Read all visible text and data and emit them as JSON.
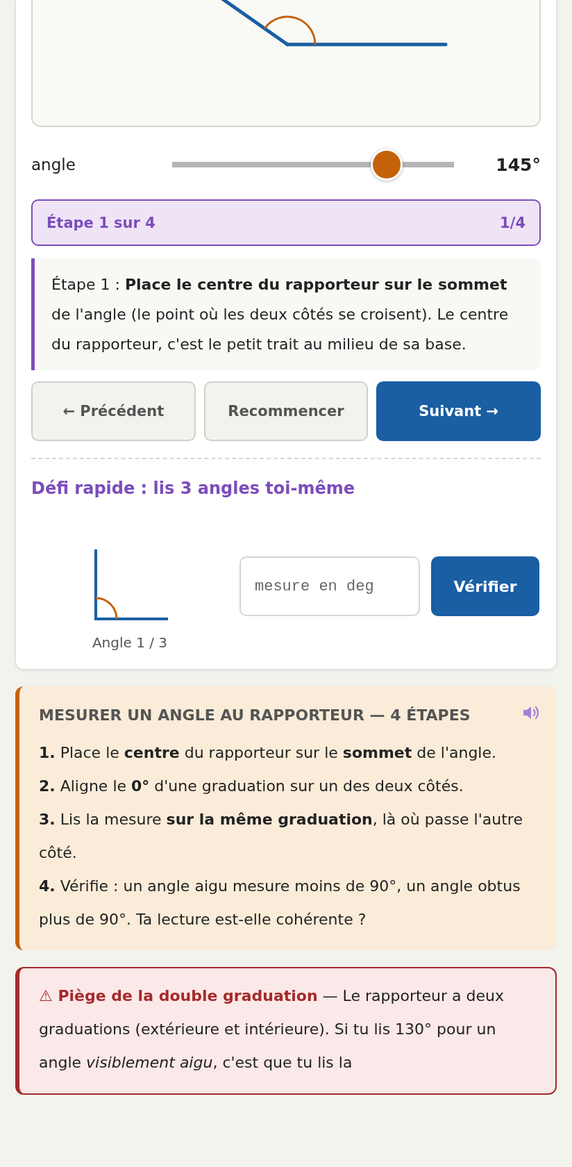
{
  "slider": {
    "label": "angle",
    "level": 0.76,
    "reading": "145°"
  },
  "step_banner": {
    "title": "Étape 1 sur 4",
    "counter": "1/4"
  },
  "instruction": "Étape 1 : **Place le centre du rapporteur sur le sommet** de l'angle (le point où les deux côtés se croisent). Le centre du rapporteur, c'est le petit trait au milieu de sa base.",
  "buttons": [
    {
      "label": "← Précédent",
      "kind": "secondary"
    },
    {
      "label": "Recommencer",
      "kind": "secondary"
    },
    {
      "label": "Suivant →",
      "kind": "primary"
    }
  ],
  "challenge": {
    "title": "Défi rapide : lis 3 angles toi-même",
    "caption": "Angle 1 / 3",
    "input": {
      "placeholder": "mesure en deg"
    },
    "button": "Vérifier"
  },
  "method": {
    "title": "MESURER UN ANGLE AU RAPPORTEUR — 4 ÉTAPES",
    "steps": [
      "**1.** Place le **centre** du rapporteur sur le **sommet** de l'angle.",
      "**2.** Aligne le **0°** d'une graduation sur un des deux côtés.",
      "**3.** Lis la mesure **sur la même graduation**, là où passe l'autre côté.",
      "**4.** Vérifie : un angle aigu mesure moins de 90°, un angle obtus plus de 90°. Ta lecture est-elle cohérente ?"
    ]
  },
  "warning": "**⚠ Piège de la double graduation** — Le rapporteur a deux graduations (extérieure et intérieure). Si tu lis 130° pour un angle *visiblement aigu*, c'est que tu lis la"
}
